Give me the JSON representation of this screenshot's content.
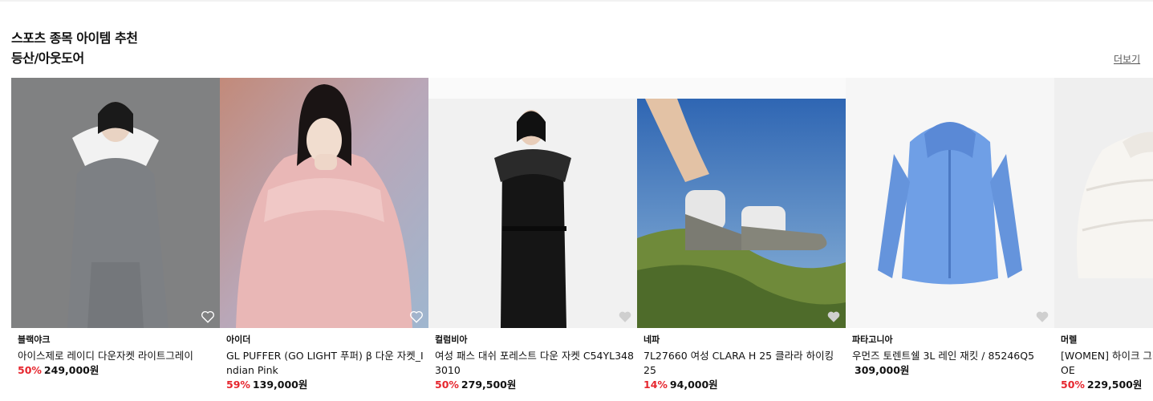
{
  "section": {
    "title": "스포츠 종목 아이템 추천",
    "subtitle": "등산/아웃도어",
    "more_label": "더보기"
  },
  "products": [
    {
      "brand": "블랙야크",
      "name": "아이스제로 레이디 다운자켓 라이트그레이",
      "discount": "50%",
      "price": "249,000원",
      "image": "woman-grey-down-coat-photo",
      "wishlist_icon": "heart-outline-white-icon"
    },
    {
      "brand": "아이더",
      "name": "GL PUFFER (GO LIGHT 푸퍼) β 다운 자켓_Indian Pink",
      "discount": "59%",
      "price": "139,000원",
      "image": "woman-pink-puffer-photo",
      "wishlist_icon": "heart-outline-white-icon"
    },
    {
      "brand": "컬럼비아",
      "name": "여성 패스 대쉬 포레스트 다운 자켓 C54YL3483010",
      "discount": "50%",
      "price": "279,500원",
      "image": "woman-black-long-down-photo",
      "wishlist_icon": "heart-filled-grey-icon"
    },
    {
      "brand": "네파",
      "name": "7L27660 여성 CLARA H 25 클라라 하이킹 25",
      "discount": "14%",
      "price": "94,000원",
      "image": "hiking-shoes-outdoor-photo",
      "wishlist_icon": "heart-filled-grey-icon"
    },
    {
      "brand": "파타고니아",
      "name": "우먼즈 토렌트쉘 3L 레인 재킷 / 85246Q5",
      "discount": "",
      "price": "309,000원",
      "image": "blue-rain-jacket-photo",
      "wishlist_icon": "heart-filled-grey-icon"
    },
    {
      "brand": "머렐",
      "name": "[WOMEN] 하이크 그라운드 다운 자켓 IVORY/OE",
      "discount": "50%",
      "price": "229,500원",
      "image": "ivory-puffer-photo",
      "wishlist_icon": "heart-filled-grey-icon"
    }
  ]
}
